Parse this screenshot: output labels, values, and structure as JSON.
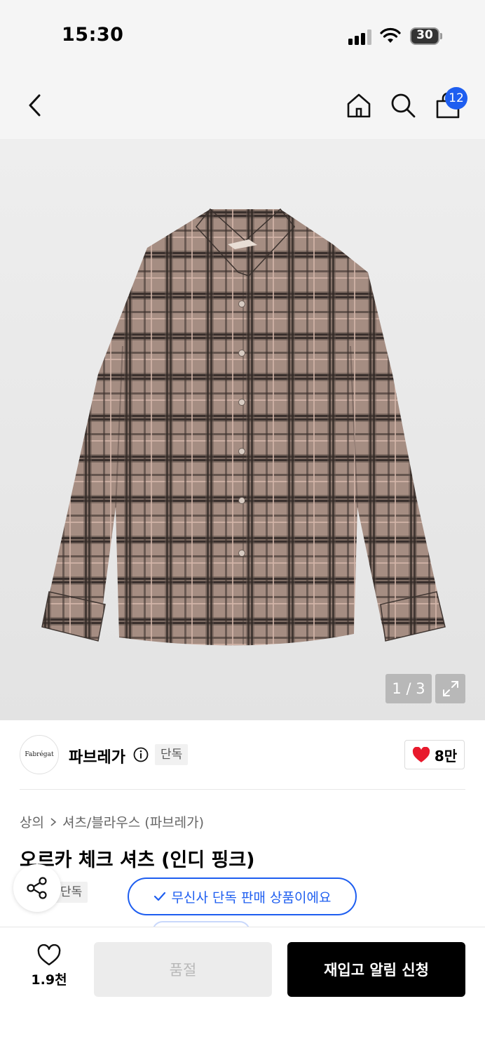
{
  "status_bar": {
    "time": "15:30",
    "battery": "30"
  },
  "nav": {
    "cart_badge": "12",
    "icons": [
      "back-arrow-icon",
      "home-icon",
      "search-icon",
      "shopping-bag-icon"
    ]
  },
  "gallery": {
    "counter": "1 / 3",
    "current_image": 1,
    "total_images": 3
  },
  "brand": {
    "logo_text": "Fabrégat",
    "name": "파브레가",
    "exclusive_tag": "단독",
    "like_count": "8만"
  },
  "product": {
    "breadcrumb": [
      "상의",
      "셔츠/블라우스 (파브레가)"
    ],
    "title": "오르카 체크 셔츠 (인디 핑크)",
    "exclusive_tag": "단독",
    "exclusive_banner": "무신사 단독 판매 상품이에요"
  },
  "bottom_bar": {
    "wish_count": "1.9천",
    "soldout_label": "품절",
    "restock_label": "재입고 알림 신청"
  },
  "colors": {
    "accent": "#1e5ef0",
    "heart": "#e8192c",
    "primary_button": "#000000",
    "disabled_button": "#ececec",
    "shirt_base": "#9b8378"
  }
}
